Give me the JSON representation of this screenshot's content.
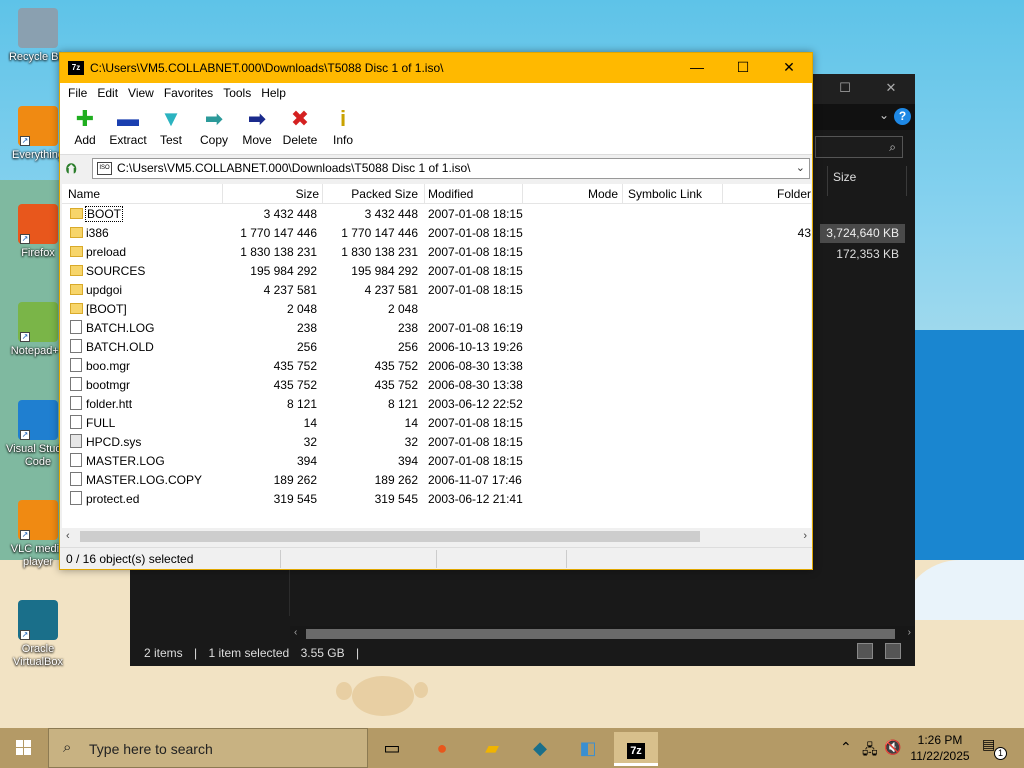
{
  "desktop": {
    "icons": [
      {
        "label": "Recycle Bin",
        "name": "recycle-bin"
      },
      {
        "label": "Everything",
        "name": "everything"
      },
      {
        "label": "Firefox",
        "name": "firefox"
      },
      {
        "label": "Notepad++",
        "name": "notepadpp"
      },
      {
        "label": "Visual Studio Code",
        "name": "vscode"
      },
      {
        "label": "VLC media player",
        "name": "vlc"
      },
      {
        "label": "Oracle VirtualBox",
        "name": "virtualbox"
      }
    ]
  },
  "explorer": {
    "column_size": "Size",
    "row1_size": "3,724,640 KB",
    "row2_size": "172,353 KB",
    "partial_value": "43",
    "status_items": "2 items",
    "status_selected": "1 item selected",
    "status_size": "3.55 GB"
  },
  "sevenzip": {
    "title": "C:\\Users\\VM5.COLLABNET.000\\Downloads\\T5088 Disc 1 of 1.iso\\",
    "menu": [
      "File",
      "Edit",
      "View",
      "Favorites",
      "Tools",
      "Help"
    ],
    "toolbar": [
      {
        "label": "Add",
        "icon": "add-icon",
        "glyph": "✚",
        "color": "#1fae1f"
      },
      {
        "label": "Extract",
        "icon": "extract-icon",
        "glyph": "▬",
        "color": "#1a3fb0"
      },
      {
        "label": "Test",
        "icon": "test-icon",
        "glyph": "▼",
        "color": "#2bb3c0"
      },
      {
        "label": "Copy",
        "icon": "copy-icon",
        "glyph": "➡",
        "color": "#2c9a9a"
      },
      {
        "label": "Move",
        "icon": "move-icon",
        "glyph": "➡",
        "color": "#1a2a8c"
      },
      {
        "label": "Delete",
        "icon": "delete-icon",
        "glyph": "✖",
        "color": "#d42020"
      },
      {
        "label": "Info",
        "icon": "info-icon",
        "glyph": "i",
        "color": "#c9a200"
      }
    ],
    "address": "C:\\Users\\VM5.COLLABNET.000\\Downloads\\T5088 Disc 1 of 1.iso\\",
    "columns": [
      "Name",
      "Size",
      "Packed Size",
      "Modified",
      "Mode",
      "Symbolic Link",
      "Folder"
    ],
    "rows": [
      {
        "name": "BOOT",
        "size": "3 432 448",
        "packed": "3 432 448",
        "modified": "2007-01-08 18:15",
        "type": "folder"
      },
      {
        "name": "i386",
        "size": "1 770 147 446",
        "packed": "1 770 147 446",
        "modified": "2007-01-08 18:15",
        "type": "folder"
      },
      {
        "name": "preload",
        "size": "1 830 138 231",
        "packed": "1 830 138 231",
        "modified": "2007-01-08 18:15",
        "type": "folder"
      },
      {
        "name": "SOURCES",
        "size": "195 984 292",
        "packed": "195 984 292",
        "modified": "2007-01-08 18:15",
        "type": "folder"
      },
      {
        "name": "updgoi",
        "size": "4 237 581",
        "packed": "4 237 581",
        "modified": "2007-01-08 18:15",
        "type": "folder"
      },
      {
        "name": "[BOOT]",
        "size": "2 048",
        "packed": "2 048",
        "modified": "",
        "type": "folder"
      },
      {
        "name": "BATCH.LOG",
        "size": "238",
        "packed": "238",
        "modified": "2007-01-08 16:19",
        "type": "file"
      },
      {
        "name": "BATCH.OLD",
        "size": "256",
        "packed": "256",
        "modified": "2006-10-13 19:26",
        "type": "file"
      },
      {
        "name": "boo.mgr",
        "size": "435 752",
        "packed": "435 752",
        "modified": "2006-08-30 13:38",
        "type": "file"
      },
      {
        "name": "bootmgr",
        "size": "435 752",
        "packed": "435 752",
        "modified": "2006-08-30 13:38",
        "type": "file"
      },
      {
        "name": "folder.htt",
        "size": "8 121",
        "packed": "8 121",
        "modified": "2003-06-12 22:52",
        "type": "file"
      },
      {
        "name": "FULL",
        "size": "14",
        "packed": "14",
        "modified": "2007-01-08 18:15",
        "type": "file"
      },
      {
        "name": "HPCD.sys",
        "size": "32",
        "packed": "32",
        "modified": "2007-01-08 18:15",
        "type": "sys"
      },
      {
        "name": "MASTER.LOG",
        "size": "394",
        "packed": "394",
        "modified": "2007-01-08 18:15",
        "type": "file"
      },
      {
        "name": "MASTER.LOG.COPY",
        "size": "189 262",
        "packed": "189 262",
        "modified": "2006-11-07 17:46",
        "type": "file"
      },
      {
        "name": "protect.ed",
        "size": "319 545",
        "packed": "319 545",
        "modified": "2003-06-12 21:41",
        "type": "file"
      }
    ],
    "status": "0 / 16 object(s) selected"
  },
  "taskbar": {
    "search_placeholder": "Type here to search",
    "time": "1:26 PM",
    "date": "11/22/2025",
    "notification_count": "1"
  }
}
